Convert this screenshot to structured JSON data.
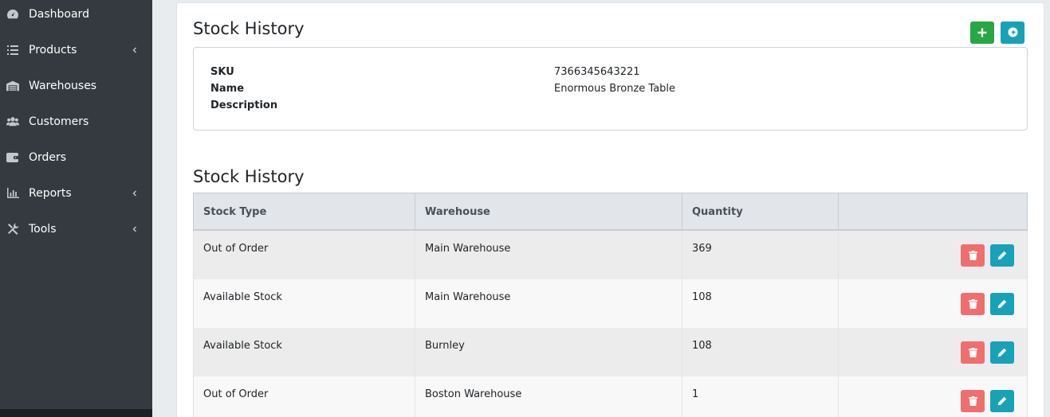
{
  "sidebar": {
    "items": [
      {
        "label": "Dashboard",
        "icon": "dashboard-icon",
        "has_submenu": false
      },
      {
        "label": "Products",
        "icon": "list-icon",
        "has_submenu": true
      },
      {
        "label": "Warehouses",
        "icon": "warehouse-icon",
        "has_submenu": false
      },
      {
        "label": "Customers",
        "icon": "users-icon",
        "has_submenu": false
      },
      {
        "label": "Orders",
        "icon": "wallet-icon",
        "has_submenu": false
      },
      {
        "label": "Reports",
        "icon": "chart-icon",
        "has_submenu": true
      },
      {
        "label": "Tools",
        "icon": "tools-icon",
        "has_submenu": true
      }
    ]
  },
  "header": {
    "title": "Stock History",
    "add_icon": "plus-icon",
    "back_icon": "arrow-circle-left-icon"
  },
  "product": {
    "sku_label": "SKU",
    "sku_value": "7366345643221",
    "name_label": "Name",
    "name_value": "Enormous Bronze Table",
    "description_label": "Description",
    "description_value": ""
  },
  "history": {
    "title": "Stock History",
    "columns": [
      "Stock Type",
      "Warehouse",
      "Quantity",
      ""
    ],
    "rows": [
      {
        "stock_type": "Out of Order",
        "warehouse": "Main Warehouse",
        "quantity": "369"
      },
      {
        "stock_type": "Available Stock",
        "warehouse": "Main Warehouse",
        "quantity": "108"
      },
      {
        "stock_type": "Available Stock",
        "warehouse": "Burnley",
        "quantity": "108"
      },
      {
        "stock_type": "Out of Order",
        "warehouse": "Boston Warehouse",
        "quantity": "1"
      }
    ]
  },
  "colors": {
    "sidebar_bg": "#343a40",
    "success": "#28a745",
    "info": "#17a2b8",
    "danger": "#f06e6e"
  }
}
